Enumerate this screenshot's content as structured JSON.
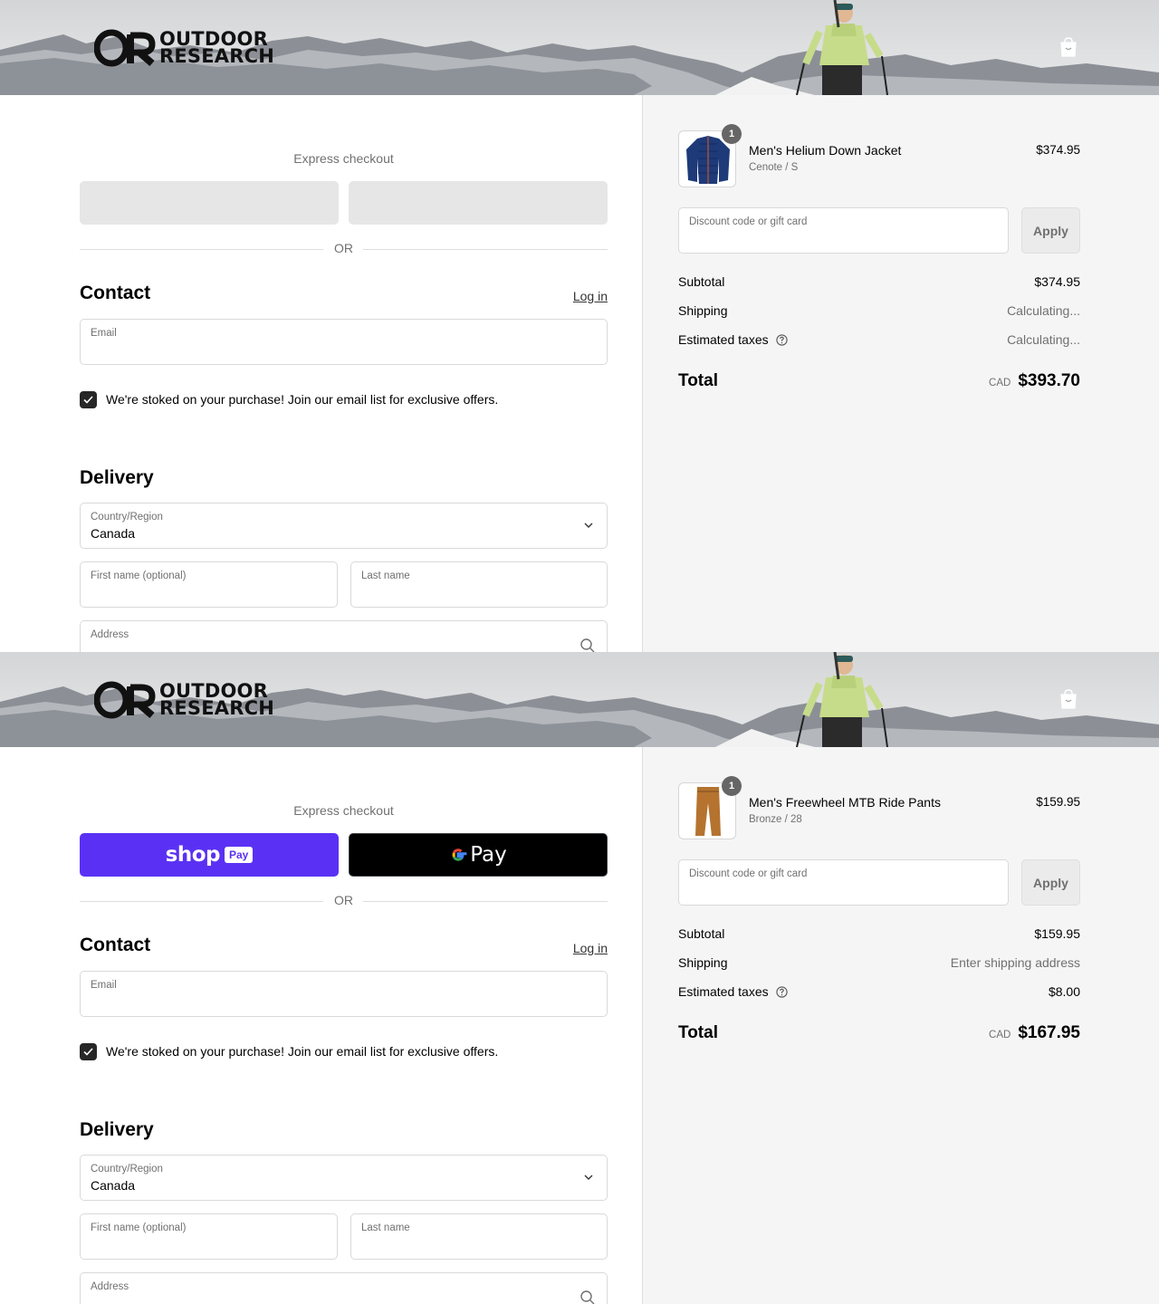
{
  "panels": [
    {
      "brand": {
        "line1": "OUTDOOR",
        "line2": "RESEARCH",
        "mark": "OR"
      },
      "express": {
        "title": "Express checkout",
        "loaded": false,
        "or_text": "OR"
      },
      "contact": {
        "heading": "Contact",
        "login": "Log in",
        "email_label": "Email",
        "newsletter": "We're stoked on your purchase! Join our email list for exclusive offers."
      },
      "delivery": {
        "heading": "Delivery",
        "country_label": "Country/Region",
        "country_value": "Canada",
        "first_name_label": "First name (optional)",
        "last_name_label": "Last name",
        "address_label": "Address"
      },
      "order": {
        "item": {
          "qty": "1",
          "name": "Men's Helium Down Jacket",
          "variant": "Cenote / S",
          "price": "$374.95",
          "thumb": "jacket"
        },
        "discount_label": "Discount code or gift card",
        "apply": "Apply",
        "subtotal_label": "Subtotal",
        "subtotal": "$374.95",
        "shipping_label": "Shipping",
        "shipping": "Calculating...",
        "taxes_label": "Estimated taxes",
        "taxes": "Calculating...",
        "total_label": "Total",
        "currency": "CAD",
        "total": "$393.70"
      }
    },
    {
      "brand": {
        "line1": "OUTDOOR",
        "line2": "RESEARCH",
        "mark": "OR"
      },
      "express": {
        "title": "Express checkout",
        "loaded": true,
        "or_text": "OR",
        "shop_word": "shop",
        "shop_pay": "Pay",
        "gpay_word": "Pay"
      },
      "contact": {
        "heading": "Contact",
        "login": "Log in",
        "email_label": "Email",
        "newsletter": "We're stoked on your purchase! Join our email list for exclusive offers."
      },
      "delivery": {
        "heading": "Delivery",
        "country_label": "Country/Region",
        "country_value": "Canada",
        "first_name_label": "First name (optional)",
        "last_name_label": "Last name",
        "address_label": "Address"
      },
      "order": {
        "item": {
          "qty": "1",
          "name": "Men's Freewheel MTB Ride Pants",
          "variant": "Bronze / 28",
          "price": "$159.95",
          "thumb": "pants"
        },
        "discount_label": "Discount code or gift card",
        "apply": "Apply",
        "subtotal_label": "Subtotal",
        "subtotal": "$159.95",
        "shipping_label": "Shipping",
        "shipping": "Enter shipping address",
        "taxes_label": "Estimated taxes",
        "taxes": "$8.00",
        "total_label": "Total",
        "currency": "CAD",
        "total": "$167.95"
      }
    }
  ],
  "colors": {
    "shop_pay": "#5a31f4",
    "gpay": "#000000",
    "sidebar_bg": "#f5f5f5",
    "checkbox": "#272727",
    "placeholder_button": "#e6e6e6"
  }
}
